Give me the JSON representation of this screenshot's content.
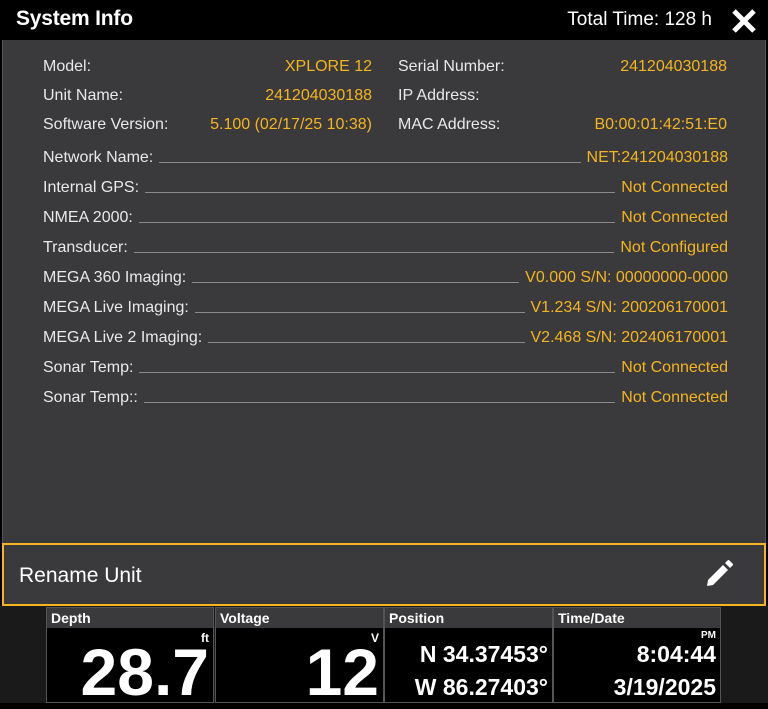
{
  "header": {
    "title": "System Info",
    "total_time": "Total Time: 128 h",
    "close_icon": "close-icon"
  },
  "info_grid": {
    "left": [
      {
        "label": "Model:",
        "value": "XPLORE 12"
      },
      {
        "label": "Unit Name:",
        "value": "241204030188"
      },
      {
        "label": "Software Version:",
        "value": "5.100 (02/17/25 10:38)"
      }
    ],
    "right": [
      {
        "label": "Serial Number:",
        "value": "241204030188"
      },
      {
        "label": "IP Address:",
        "value": ""
      },
      {
        "label": "MAC Address:",
        "value": "B0:00:01:42:51:E0"
      }
    ]
  },
  "rows": [
    {
      "label": "Network Name:",
      "value": "NET:241204030188"
    },
    {
      "label": "Internal GPS:",
      "value": "Not Connected"
    },
    {
      "label": "NMEA 2000:",
      "value": "Not Connected"
    },
    {
      "label": "Transducer:",
      "value": "Not Configured"
    },
    {
      "label": "MEGA 360 Imaging:",
      "value": "V0.000 S/N: 00000000-0000"
    },
    {
      "label": "MEGA Live Imaging:",
      "value": "V1.234 S/N: 200206170001"
    },
    {
      "label": "MEGA Live 2 Imaging:",
      "value": "V2.468 S/N: 202406170001"
    },
    {
      "label": "Sonar Temp:",
      "value": "Not Connected"
    },
    {
      "label": "Sonar Temp::",
      "value": "Not Connected"
    }
  ],
  "rename": {
    "label": "Rename Unit",
    "icon": "pencil-icon"
  },
  "status_bar": {
    "depth": {
      "caption": "Depth",
      "unit": "ft",
      "value": "28.7"
    },
    "voltage": {
      "caption": "Voltage",
      "unit": "V",
      "value": "12"
    },
    "position": {
      "caption": "Position",
      "lat": "N 34.37453°",
      "lon": "W 86.27403°"
    },
    "time_date": {
      "caption": "Time/Date",
      "ampm": "PM",
      "time": "8:04:44",
      "date": "3/19/2025"
    }
  },
  "colors": {
    "accent": "#f5b51e",
    "panel": "#3a3a3c",
    "background": "#000000"
  }
}
